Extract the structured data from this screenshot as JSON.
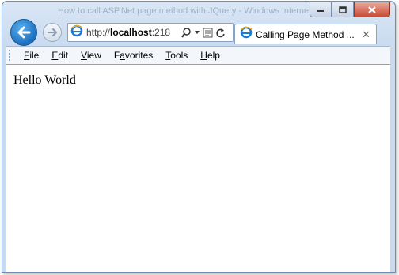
{
  "window": {
    "title": "How to call ASP.Net page method with JQuery - Windows Internet Explorer"
  },
  "address_bar": {
    "url_prefix": "http://",
    "url_host": "localhost",
    "url_rest": ":218"
  },
  "tab": {
    "label": "Calling Page Method ...",
    "close": "✕"
  },
  "menu": {
    "items": [
      {
        "key": "F",
        "rest": "ile"
      },
      {
        "key": "E",
        "rest": "dit"
      },
      {
        "key": "V",
        "rest": "iew"
      },
      {
        "key": "",
        "pre": "F",
        "key2": "a",
        "rest": "vorites"
      },
      {
        "key": "T",
        "rest": "ools"
      },
      {
        "key": "H",
        "rest": "elp"
      }
    ]
  },
  "page": {
    "body_text": "Hello World"
  },
  "colors": {
    "back_button": "#1c6fbf",
    "close_button": "#c74b35"
  },
  "icons": [
    "back-arrow-icon",
    "forward-arrow-icon",
    "ie-logo-icon",
    "search-icon",
    "dropdown-icon",
    "compatibility-view-icon",
    "refresh-icon",
    "minimize-icon",
    "maximize-icon",
    "close-icon"
  ]
}
